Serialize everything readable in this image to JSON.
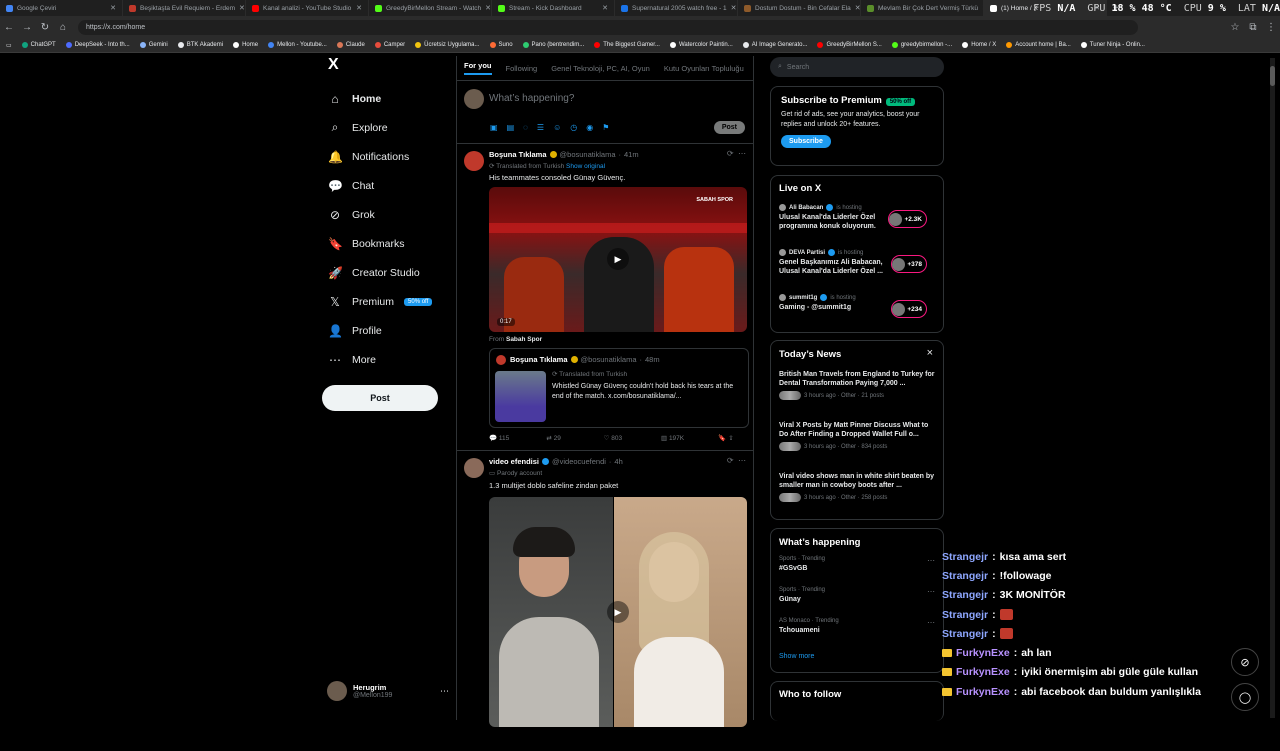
{
  "browser": {
    "tabs": [
      {
        "title": "Google Çeviri",
        "color": "#4285f4"
      },
      {
        "title": "Beşiktaşta Evil Requiem - Erdem",
        "color": "#c0392b"
      },
      {
        "title": "Kanal analizi - YouTube Studio",
        "color": "#ff0000"
      },
      {
        "title": "GreedyBirMellon Stream - Watch",
        "color": "#53fc18"
      },
      {
        "title": "Stream - Kick Dashboard",
        "color": "#53fc18"
      },
      {
        "title": "Supernatural 2005 watch free - 1",
        "color": "#1a73e8"
      },
      {
        "title": "Dostum Dostum - Bin Cefalar Ela",
        "color": "#8e5a2a"
      },
      {
        "title": "Mevlam Bir Çok Dert Vermiş Türkü",
        "color": "#5a8e2a"
      },
      {
        "title": "(1) Home / X",
        "color": "#ffffff"
      }
    ],
    "url": "https://x.com/home",
    "bookmarks": [
      {
        "label": "ChatGPT",
        "color": "#10a37f"
      },
      {
        "label": "DeepSeek - Into th...",
        "color": "#4d6bfe"
      },
      {
        "label": "Gemini",
        "color": "#8ab4f8"
      },
      {
        "label": "BTK Akademi",
        "color": "#e8eaed"
      },
      {
        "label": "Home",
        "color": "#ffffff"
      },
      {
        "label": "Mellon - Youtube...",
        "color": "#4285f4"
      },
      {
        "label": "Claude",
        "color": "#d97757"
      },
      {
        "label": "Camper",
        "color": "#e74c3c"
      },
      {
        "label": "Ücretsiz Uygulama...",
        "color": "#f1c40f"
      },
      {
        "label": "Suno",
        "color": "#ff6b35"
      },
      {
        "label": "Pano (bentrendim...",
        "color": "#2ecc71"
      },
      {
        "label": "The Biggest Gamer...",
        "color": "#ff0000"
      },
      {
        "label": "Watercolor Paintin...",
        "color": "#ffffff"
      },
      {
        "label": "AI Image Generato...",
        "color": "#e8eaed"
      },
      {
        "label": "GreedyBirMellon S...",
        "color": "#ff0000"
      },
      {
        "label": "greedybirmellon -...",
        "color": "#53fc18"
      },
      {
        "label": "Home / X",
        "color": "#ffffff"
      },
      {
        "label": "Account home | Ba...",
        "color": "#ff9900"
      },
      {
        "label": "Tuner Ninja - Onlin...",
        "color": "#ffffff"
      }
    ]
  },
  "overlay": {
    "fps_label": "FPS",
    "fps": "N/A",
    "gpu_label": "GPU",
    "gpu": "18 % 48 °C",
    "cpu_label": "CPU",
    "cpu": "9 %",
    "lat_label": "LAT",
    "lat": "N/A"
  },
  "nav": {
    "logo": "X",
    "items": [
      {
        "label": "Home",
        "icon": "home-icon",
        "glyph": "⌂"
      },
      {
        "label": "Explore",
        "icon": "search-icon",
        "glyph": "⌕"
      },
      {
        "label": "Notifications",
        "icon": "bell-icon",
        "glyph": "🔔"
      },
      {
        "label": "Chat",
        "icon": "chat-icon",
        "glyph": "💬"
      },
      {
        "label": "Grok",
        "icon": "grok-icon",
        "glyph": "⊘"
      },
      {
        "label": "Bookmarks",
        "icon": "bookmark-icon",
        "glyph": "🔖"
      },
      {
        "label": "Creator Studio",
        "icon": "rocket-icon",
        "glyph": "🚀"
      },
      {
        "label": "Premium",
        "icon": "x-icon",
        "glyph": "𝕏"
      },
      {
        "label": "Profile",
        "icon": "person-icon",
        "glyph": "👤"
      },
      {
        "label": "More",
        "icon": "more-icon",
        "glyph": "⋯"
      }
    ],
    "premium_badge": "50% off",
    "post_label": "Post",
    "user_name": "Herugrim",
    "user_handle": "@Mellon199"
  },
  "feed": {
    "tabs": [
      "For you",
      "Following",
      "Genel Teknoloji, PC, AI, Oyun",
      "Kutu Oyunları Topluluğu"
    ],
    "compose_placeholder": "What’s happening?",
    "compose_post": "Post",
    "tweets": [
      {
        "name": "Boşuna Tıklama",
        "handle": "@bosunatiklama",
        "time": "41m",
        "translated": "Translated from Turkish",
        "show_original": "Show original",
        "text": "His teammates consoled Günay Güvenç.",
        "video_brand": "SABAH SPOR",
        "duration": "0:17",
        "from_label": "From",
        "from_source": "Sabah Spor",
        "quote": {
          "name": "Boşuna Tıklama",
          "handle": "@bosunatiklama",
          "time": "48m",
          "translated": "Translated from Turkish",
          "text": "Whistled Günay Güvenç couldn't hold back his tears at the end of the match. x.com/bosunatiklama/..."
        },
        "replies": "115",
        "reposts": "29",
        "likes": "803",
        "views": "197K"
      },
      {
        "name": "video efendisi",
        "handle": "@videocuefendi",
        "time": "4h",
        "parody": "Parody account",
        "text": "1.3 multijet doblo safeline zindan paket"
      }
    ]
  },
  "right": {
    "search_placeholder": "Search",
    "premium": {
      "title": "Subscribe to Premium",
      "badge": "50% off",
      "text": "Get rid of ads, see your analytics, boost your replies and unlock 20+ features.",
      "button": "Subscribe"
    },
    "live": {
      "title": "Live on X",
      "items": [
        {
          "host": "Ali Babacan",
          "status": "is hosting",
          "title": "Ulusal Kanal'da Liderler Özel programına konuk oluyorum.",
          "count": "+2.3K"
        },
        {
          "host": "DEVA Partisi",
          "status": "is hosting",
          "title": "Genel Başkanımız Ali Babacan, Ulusal Kanal'da Liderler Özel ...",
          "count": "+378"
        },
        {
          "host": "summit1g",
          "status": "is hosting",
          "title": "Gaming - @summit1g",
          "count": "+234"
        }
      ]
    },
    "news": {
      "title": "Today’s News",
      "close": "×",
      "items": [
        {
          "title": "British Man Travels from England to Turkey for Dental Transformation Paying 7,000 ...",
          "meta": "3 hours ago · Other · 21 posts"
        },
        {
          "title": "Viral X Posts by Matt Pinner Discuss What to Do After Finding a Dropped Wallet Full o...",
          "meta": "3 hours ago · Other · 834 posts"
        },
        {
          "title": "Viral video shows man in white shirt beaten by smaller man in cowboy boots after ...",
          "meta": "3 hours ago · Other · 258 posts"
        }
      ]
    },
    "happening": {
      "title": "What’s happening",
      "items": [
        {
          "context": "Sports · Trending",
          "topic": "#GSvGB"
        },
        {
          "context": "Sports · Trending",
          "topic": "Günay"
        },
        {
          "context": "AS Monaco · Trending",
          "topic": "Tchouameni"
        }
      ],
      "show_more": "Show more"
    },
    "follow": {
      "title": "Who to follow"
    }
  },
  "chat": [
    {
      "user": "Strangejr",
      "sep": ":",
      "msg": "kısa ama sert",
      "type": "plain"
    },
    {
      "user": "Strangejr",
      "sep": ":",
      "msg": "!followage",
      "type": "plain"
    },
    {
      "user": "Strangejr",
      "sep": ":",
      "msg": "3K MONİTÖR",
      "type": "plain"
    },
    {
      "user": "Strangejr",
      "sep": ":",
      "msg": "",
      "type": "emote"
    },
    {
      "user": "Strangejr",
      "sep": ":",
      "msg": "",
      "type": "emote"
    },
    {
      "user": "FurkynExe",
      "sep": ":",
      "msg": "ah lan",
      "type": "crown"
    },
    {
      "user": "FurkynExe",
      "sep": ":",
      "msg": "iyiki önermişim abi güle güle kullan",
      "type": "crown"
    },
    {
      "user": "FurkynExe",
      "sep": ":",
      "msg": "abi facebook dan buldum yanlışlıkla",
      "type": "crown"
    }
  ]
}
